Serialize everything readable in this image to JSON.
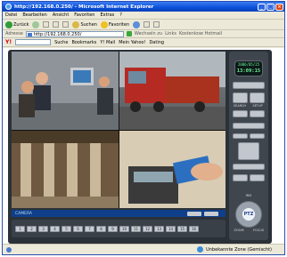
{
  "window": {
    "title": "http://192.168.0.250/ - Microsoft Internet Explorer"
  },
  "menu": [
    "Datei",
    "Bearbeiten",
    "Ansicht",
    "Favoriten",
    "Extras",
    "?"
  ],
  "toolbar": {
    "back": "Zurück",
    "search": "Suchen",
    "favorites": "Favoriten"
  },
  "address": {
    "label": "Adresse",
    "url": "http://192.168.0.250/",
    "go": "Wechseln zu",
    "links": "Links",
    "hotmail": "Kostenlose Hotmail"
  },
  "links": {
    "search_btn": "Suche",
    "bookmarks": "Bookmarks",
    "mail": "Y! Mail",
    "myyahoo": "Mein Yahoo!",
    "dating": "Dating"
  },
  "viewer": {
    "camera_label": "CAMERA",
    "clock_date": "2006/05/25",
    "clock_time": "13:09:15",
    "cameras": [
      "1",
      "2",
      "3",
      "4",
      "5",
      "6",
      "7",
      "8",
      "9",
      "10",
      "11",
      "12",
      "13",
      "14",
      "15",
      "16"
    ],
    "ptz": "PTZ",
    "zoom": "ZOOM",
    "focus": "FOCUS",
    "iris": "IRIS",
    "search": "SEARCH",
    "setup": "SETUP"
  },
  "status": {
    "zone": "Unbekannte Zone (Gemischt)"
  }
}
